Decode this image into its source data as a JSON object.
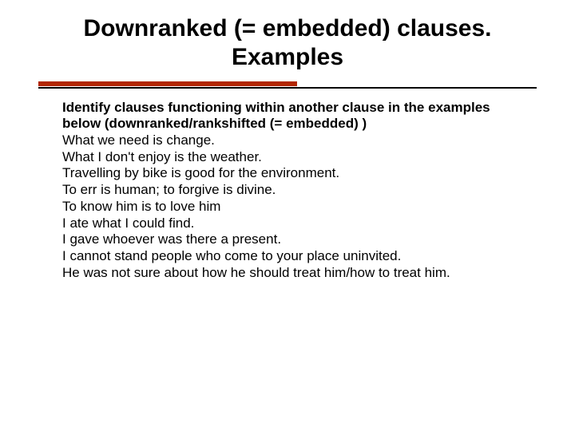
{
  "title": "Downranked (= embedded) clauses. Examples",
  "instruction": "Identify clauses functioning within another clause in the examples below (downranked/rankshifted (= embedded) )",
  "examples": [
    "What we need is change.",
    "What I don't enjoy is the weather.",
    "Travelling by bike is good for the environment.",
    "To err is human; to forgive is divine.",
    "To know him is to love him",
    "I ate what I could find.",
    "I gave whoever was there a present.",
    "I cannot stand people who come to your place uninvited.",
    "He was not sure about how he should treat him/how to treat him."
  ]
}
